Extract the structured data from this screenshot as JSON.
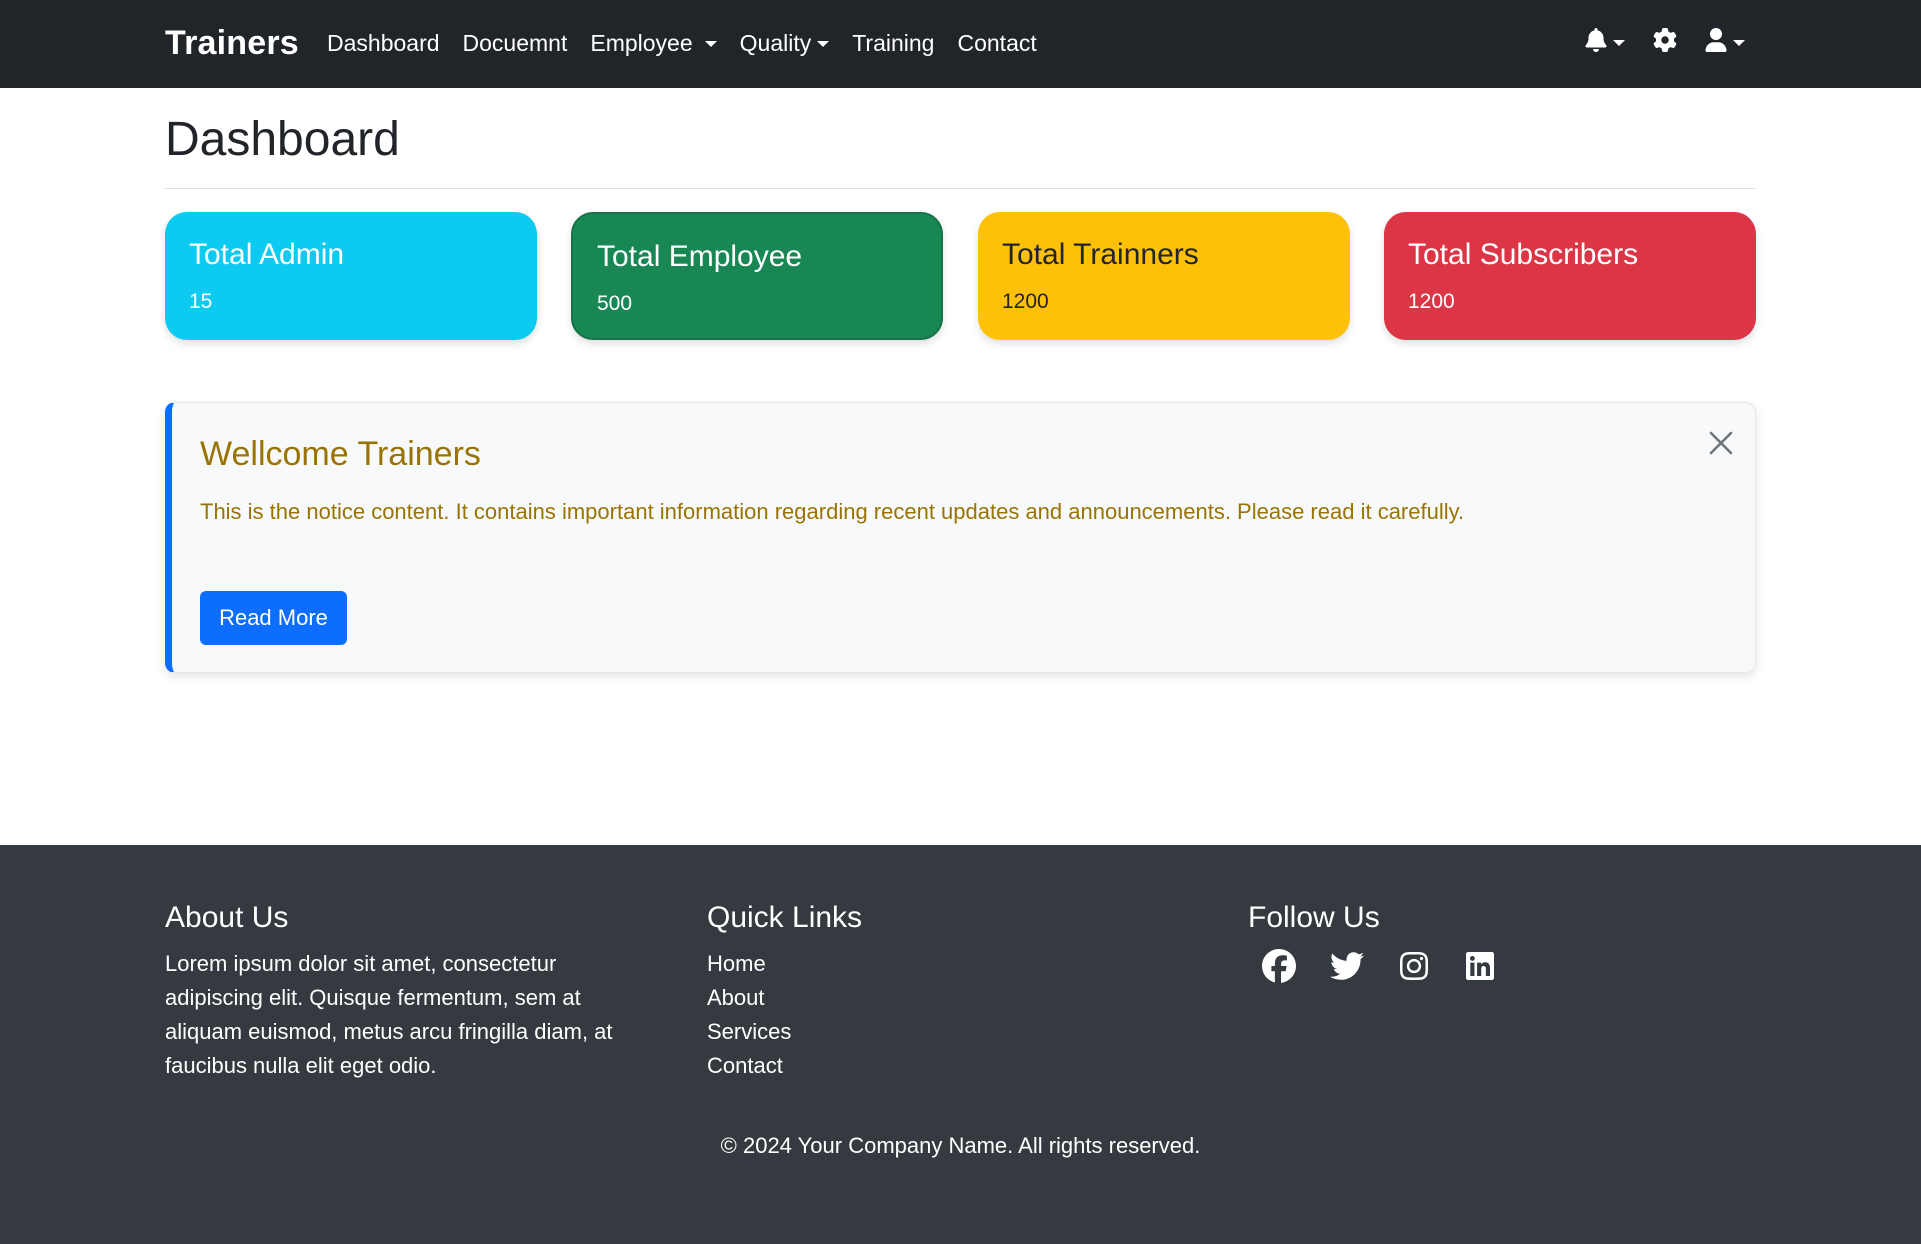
{
  "navbar": {
    "brand": "Trainers",
    "links": [
      {
        "label": "Dashboard",
        "dropdown": false
      },
      {
        "label": "Docuemnt",
        "dropdown": false
      },
      {
        "label": "Employee",
        "dropdown": true
      },
      {
        "label": "Quality",
        "dropdown": true
      },
      {
        "label": "Training",
        "dropdown": false
      },
      {
        "label": "Contact",
        "dropdown": false
      }
    ],
    "right_icons": [
      "bell-icon",
      "gear-icon",
      "user-icon"
    ]
  },
  "page": {
    "title": "Dashboard"
  },
  "stats": [
    {
      "label": "Total Admin",
      "value": "15",
      "color": "#0dcaf0"
    },
    {
      "label": "Total Employee",
      "value": "500",
      "color": "#198754"
    },
    {
      "label": "Total Trainners",
      "value": "1200",
      "color": "#ffc107"
    },
    {
      "label": "Total Subscribers",
      "value": "1200",
      "color": "#dc3545"
    }
  ],
  "notice": {
    "title": "Wellcome Trainers",
    "text": "This is the notice content. It contains important information regarding recent updates and announcements. Please read it carefully.",
    "button_label": "Read More",
    "accent_color": "#0d6efd",
    "text_color": "#997404"
  },
  "footer": {
    "about": {
      "heading": "About Us",
      "text": "Lorem ipsum dolor sit amet, consectetur adipiscing elit. Quisque fermentum, sem at aliquam euismod, metus arcu fringilla diam, at faucibus nulla elit eget odio."
    },
    "quick_links": {
      "heading": "Quick Links",
      "items": [
        "Home",
        "About",
        "Services",
        "Contact"
      ]
    },
    "follow": {
      "heading": "Follow Us",
      "icons": [
        "facebook-icon",
        "twitter-icon",
        "instagram-icon",
        "linkedin-icon"
      ]
    },
    "copyright": "© 2024 Your Company Name. All rights reserved."
  }
}
